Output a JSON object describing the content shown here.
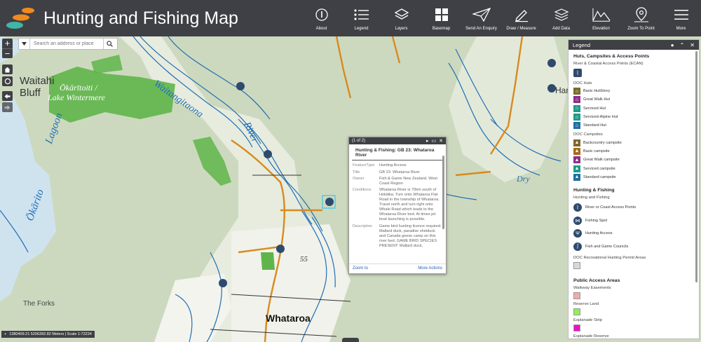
{
  "app": {
    "title": "Hunting and Fishing Map"
  },
  "toolbar": [
    {
      "label": "About",
      "icon": "info-icon"
    },
    {
      "label": "Legend",
      "icon": "legend-icon"
    },
    {
      "label": "Layers",
      "icon": "layers-icon"
    },
    {
      "label": "Basemap",
      "icon": "basemap-icon"
    },
    {
      "label": "Send An Enquiry",
      "icon": "paper-plane-icon"
    },
    {
      "label": "Draw / Measure",
      "icon": "pencil-icon"
    },
    {
      "label": "Add Data",
      "icon": "add-data-icon"
    },
    {
      "label": "Elevation",
      "icon": "elevation-icon"
    },
    {
      "label": "Zoom To Point",
      "icon": "map-pin-icon"
    },
    {
      "label": "More",
      "icon": "menu-icon"
    }
  ],
  "search": {
    "placeholder": "Search an address or place"
  },
  "map_labels": {
    "waitahi": "Waitahi",
    "bluff": "Bluff",
    "okaritoiti": "Ōkārītoiti /",
    "lake_wintermere": "Lake Wintermere",
    "waitangitaona": "Waitangitaona",
    "river": "River",
    "okarito": "Ōkārito",
    "lagoon": "Lagoon",
    "whataroa": "Whataroa",
    "the_forks": "The Forks",
    "dry": "Dry",
    "road_55": "55",
    "harihari": "Harih"
  },
  "popup": {
    "count": "(1 of 2)",
    "title": "Hunting & Fishing: GB 23: Whataroa River",
    "rows": [
      {
        "key": "FeatureType",
        "value": "Hunting Access"
      },
      {
        "key": "Title",
        "value": "GB 23: Whataroa River"
      },
      {
        "key": "Owner",
        "value": "Fish & Game New Zealand, West Coast Region"
      },
      {
        "key": "Conditions",
        "value": "Whataroa River is 70km south of Hokitika. Turn onto Whataroa Flat Road in the township of Whataroa. Travel north and turn right onto Whale Road which leads to the Whataroa River bed. At times jet boat launching is possible."
      },
      {
        "key": "Description",
        "value": "Game bird hunting licence required. Mallard duck, paradise shelduck and Canada geese camp on this river bed. GAME BIRD SPECIES PRESENT: Mallard duck,"
      }
    ],
    "zoom_to": "Zoom to",
    "more_actions": "More Actions"
  },
  "legend": {
    "title": "Legend",
    "sec1": "Huts, Campsites & Access Points",
    "ecan": "River & Coastal Access Points (ECAN)",
    "doc_huts": "DOC Huts",
    "huts": [
      {
        "label": "Basic Hut/bivvy",
        "color": "#7a6a2a"
      },
      {
        "label": "Great Walk Hut",
        "color": "#8b2d8b"
      },
      {
        "label": "Serviced Hut",
        "color": "#1e9b8a"
      },
      {
        "label": "Serviced-Alpine Hut",
        "color": "#1e9b8a"
      },
      {
        "label": "Standard Hut",
        "color": "#1d6fa3"
      }
    ],
    "doc_campsites": "DOC Campsites",
    "campsites": [
      {
        "label": "Backcountry campsite",
        "color": "#7a6a2a"
      },
      {
        "label": "Basic campsite",
        "color": "#a86a1e"
      },
      {
        "label": "Great Walk campsite",
        "color": "#8b2d8b"
      },
      {
        "label": "Serviced campsite",
        "color": "#1e9b8a"
      },
      {
        "label": "Standard campsite",
        "color": "#1d6fa3"
      }
    ],
    "sec2": "Hunting & Fishing",
    "hf_group": "Hunting and Fishing",
    "hf_items": [
      {
        "label": "River or Coast Access Points",
        "icon": "walker-icon"
      },
      {
        "label": "Fishing Spot",
        "icon": "fish-icon"
      },
      {
        "label": "Hunting Access",
        "icon": "deer-icon"
      },
      {
        "label": "Fish and Game Councils",
        "icon": "feather-icon"
      }
    ],
    "permit": "DOC Recreational Hunting Permit Areas",
    "permit_color": "#d9d9d9",
    "sec3": "Public Access Areas",
    "areas": [
      {
        "label": "Walkway Easements",
        "color": "#f4a9a9"
      },
      {
        "label": "Reserve Land",
        "color": "#8ef05a"
      },
      {
        "label": "Esplanade Strip",
        "color": "#ee10c8"
      },
      {
        "label": "Esplanade Reserve",
        "color": "#f6c96a"
      }
    ]
  },
  "scale_text": "1380409.21 5206392.82 Meters | Scale 1:72224"
}
